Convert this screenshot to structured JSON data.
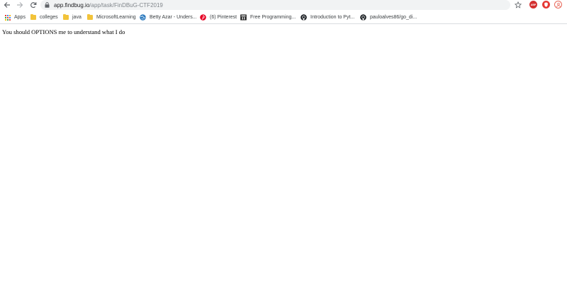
{
  "browser": {
    "url_host": "app.findbug.io",
    "url_path": "/app/task/FinDBuG-CTF2019",
    "icons": {
      "back": "back-arrow-icon",
      "forward": "forward-arrow-icon",
      "reload": "reload-icon",
      "lock": "lock-icon",
      "star": "star-icon",
      "abp_badge": "ABP"
    }
  },
  "bookmarks": [
    {
      "label": "Apps",
      "icon": "apps-grid-icon"
    },
    {
      "label": "colleges",
      "icon": "folder-icon"
    },
    {
      "label": "java",
      "icon": "folder-icon"
    },
    {
      "label": "MicrosoftLearning",
      "icon": "folder-icon"
    },
    {
      "label": "Betty Azar - Unders...",
      "icon": "globe-icon"
    },
    {
      "label": "(6) Pinterest",
      "icon": "pinterest-icon"
    },
    {
      "label": "Free Programming...",
      "icon": "site-icon"
    },
    {
      "label": "Introduction to Pyt...",
      "icon": "github-icon"
    },
    {
      "label": "pauloalves86/go_di...",
      "icon": "github-icon"
    }
  ],
  "page": {
    "message": "You should OPTIONS me to understand what I do"
  },
  "colors": {
    "omnibox_bg": "#f1f3f4",
    "folder": "#f2c33a",
    "pinterest": "#e60023",
    "abp": "#d32f2f"
  }
}
